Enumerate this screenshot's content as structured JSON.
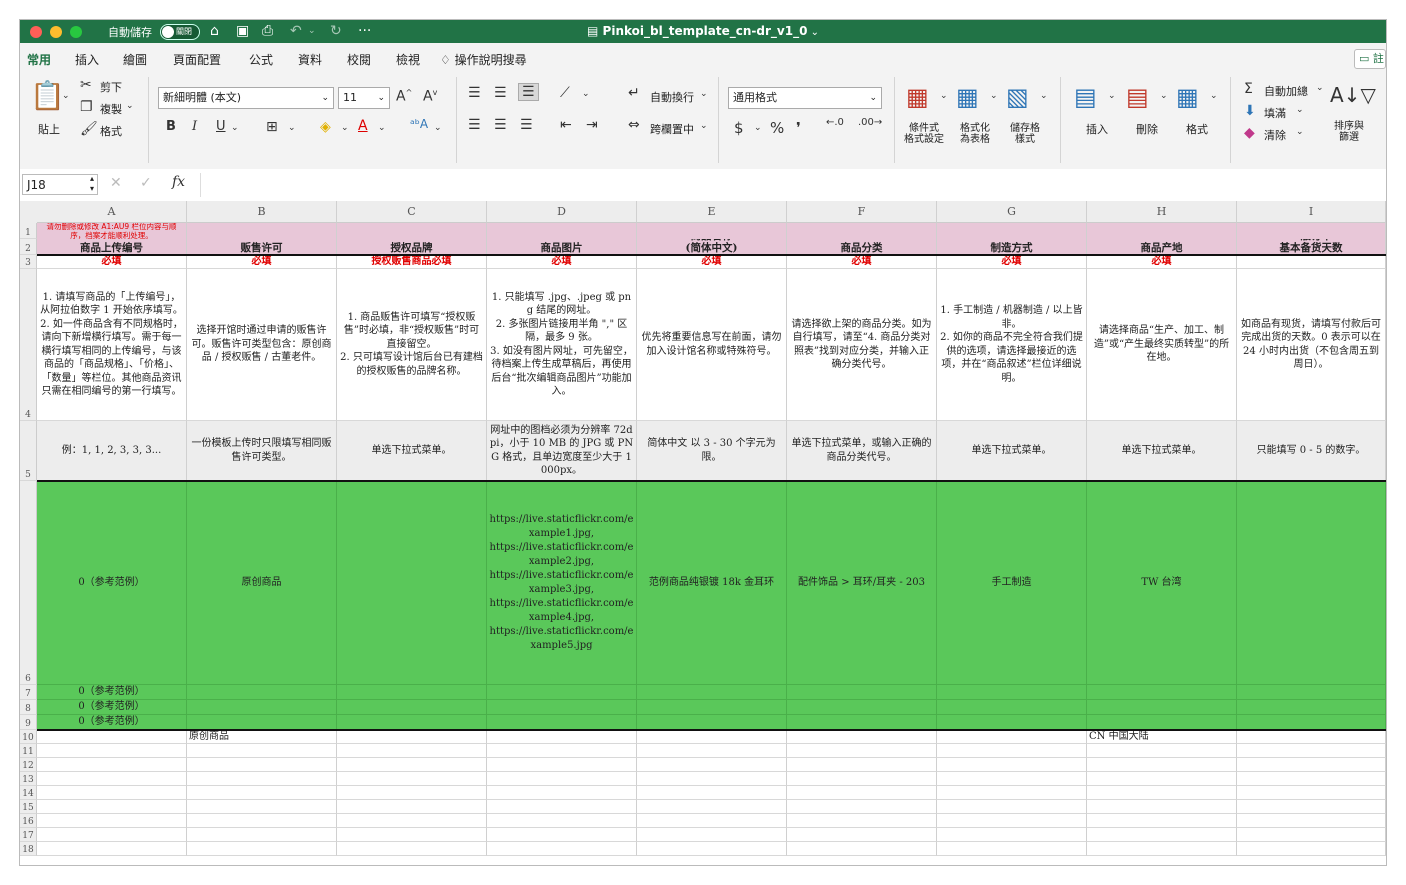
{
  "titlebar": {
    "autosave_label": "自動儲存",
    "autosave_state": "關閉",
    "doc_title": "Pinkoi_bl_template_cn-dr_v1_0"
  },
  "tabs": [
    "常用",
    "插入",
    "繪圖",
    "頁面配置",
    "公式",
    "資料",
    "校閱",
    "檢視"
  ],
  "tell_me": "操作說明搜尋",
  "ribbon": {
    "paste": "貼上",
    "cut": "剪下",
    "copy": "複製",
    "format_painter": "格式",
    "font_name": "新細明體 (本文)",
    "font_size": "11",
    "wrap_text": "自動換行",
    "merge_center": "跨欄置中",
    "number_format": "通用格式",
    "conditional_format": "條件式\n格式設定",
    "format_as_table": "格式化\n為表格",
    "cell_styles": "儲存格\n樣式",
    "insert": "插入",
    "delete": "刪除",
    "format": "格式",
    "autosum": "自動加總",
    "fill": "填滿",
    "clear": "清除",
    "sort_filter": "排序與\n篩選"
  },
  "formula_bar": {
    "name_box": "J18",
    "fx": "fx"
  },
  "columns": [
    "A",
    "B",
    "C",
    "D",
    "E",
    "F",
    "G",
    "H",
    "I"
  ],
  "row_numbers": [
    "1",
    "2",
    "3",
    "4",
    "5",
    "6",
    "7",
    "8",
    "9",
    "10",
    "11",
    "12",
    "13",
    "14",
    "15",
    "16",
    "17",
    "18"
  ],
  "note_a1": "请勿删除或修改 A1:AU9 栏位内容与顺序，档案才能顺利处理。",
  "headers": [
    "商品上传编号",
    "贩售许可",
    "授权品牌",
    "商品图片",
    "商品名称\n(简体中文)",
    "商品分类",
    "制造方式",
    "商品产地",
    "一般订单\n基本备货天数"
  ],
  "required": [
    "必填",
    "必填",
    "授权贩售商品必填",
    "必填",
    "必填",
    "必填",
    "必填",
    "必填",
    ""
  ],
  "instructions": [
    "1. 请填写商品的「上传编号」，从阿拉伯数字 1 开始依序填写。\n2. 如一件商品含有不同规格时，请向下新增横行填写。需于每一横行填写相同的上传编号，与该商品的「商品规格」、「价格」、「数量」等栏位。其他商品资讯只需在相同编号的第一行填写。",
    "选择开馆时通过申请的贩售许可。贩售许可类型包含：原创商品 / 授权贩售 / 古董老件。",
    "1. 商品贩售许可填写“授权贩售”时必填，非“授权贩售”时可直接留空。\n2. 只可填写设计馆后台已有建档的授权贩售的品牌名称。",
    "1. 只能填写 .jpg、.jpeg 或 png 结尾的网址。\n2. 多张图片链接用半角 \",\" 区隔，最多 9 张。\n3. 如没有图片网址，可先留空，待档案上传生成草稿后，再使用后台“批次编辑商品图片”功能加入。",
    "优先将重要信息写在前面，请勿加入设计馆名称或特殊符号。",
    "请选择欲上架的商品分类。如为自行填写，请至“4. 商品分类对照表”找到对应分类，并输入正确分类代号。",
    "1. 手工制造 / 机器制造 / 以上皆非。\n2. 如你的商品不完全符合我们提供的选项，请选择最接近的选项，并在“商品叙述”栏位详细说明。",
    "请选择商品“生产、加工、制造”或“产生最终实质转型”的所在地。",
    "如商品有现货，请填写付款后可完成出货的天数。0 表示可以在 24 小时内出货（不包含周五到周日）。"
  ],
  "examples": [
    "例：1, 1, 2, 3, 3, 3...",
    "一份模板上传时只限填写相同贩售许可类型。",
    "单选下拉式菜单。",
    "网址中的图档必须为分辨率 72dpi，小于 10 MB 的 JPG 或 PNG 格式，且单边宽度至少大于 1000px。",
    "简体中文 以 3 - 30 个字元为限。",
    "单选下拉式菜单，或输入正确的商品分类代号。",
    "单选下拉式菜单。",
    "单选下拉式菜单。",
    "只能填写 0 - 5 的数字。"
  ],
  "sample_row": [
    "0（参考范例）",
    "原创商品",
    "",
    "https://live.staticflickr.com/example1.jpg,\nhttps://live.staticflickr.com/example2.jpg,\nhttps://live.staticflickr.com/example3.jpg,\nhttps://live.staticflickr.com/example4.jpg,\nhttps://live.staticflickr.com/example5.jpg",
    "范例商品纯银镀 18k 金耳环",
    "配件饰品 > 耳环/耳夹 - 203",
    "手工制造",
    "TW 台湾",
    ""
  ],
  "sample_rows_extra": [
    "0（参考范例）",
    "0（参考范例）",
    "0（参考范例）"
  ],
  "row10": {
    "b": "原创商品",
    "h": "CN 中国大陆"
  }
}
